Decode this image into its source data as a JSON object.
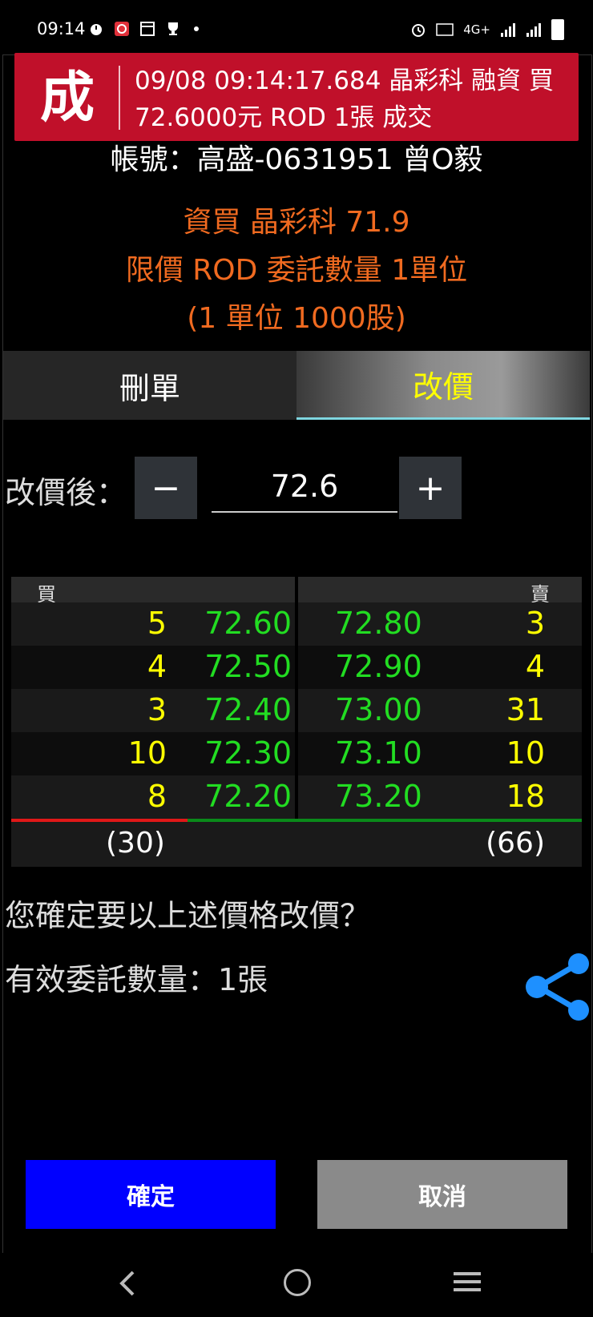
{
  "status_bar": {
    "time": "09:14",
    "left_icons": [
      "alarm-icon",
      "app-icon",
      "calendar-icon",
      "trophy-icon"
    ],
    "right_text": "4G+"
  },
  "toast": {
    "badge": "成",
    "line1": "09/08 09:14:17.684 晶彩科 融資 買",
    "line2": "72.6000元 ROD 1張 成交"
  },
  "account": "帳號：高盛-0631951 曾O毅",
  "order": {
    "line1": "資買 晶彩科 71.9",
    "line2": "限價 ROD 委託數量 1單位",
    "line3": "(1 單位 1000股)"
  },
  "tabs": [
    {
      "label": "刪單",
      "selected": false
    },
    {
      "label": "改價",
      "selected": true
    }
  ],
  "price_editor": {
    "label": "改價後：",
    "minus": "−",
    "plus": "+",
    "value": "72.6"
  },
  "order_book": {
    "buy_header": "買",
    "sell_header": "賣",
    "rows": [
      {
        "buy_vol": "5",
        "buy_price": "72.60",
        "sell_price": "72.80",
        "sell_vol": "3"
      },
      {
        "buy_vol": "4",
        "buy_price": "72.50",
        "sell_price": "72.90",
        "sell_vol": "4"
      },
      {
        "buy_vol": "3",
        "buy_price": "72.40",
        "sell_price": "73.00",
        "sell_vol": "31"
      },
      {
        "buy_vol": "10",
        "buy_price": "72.30",
        "sell_price": "73.10",
        "sell_vol": "10"
      },
      {
        "buy_vol": "8",
        "buy_price": "72.20",
        "sell_price": "73.20",
        "sell_vol": "18"
      }
    ],
    "buy_total": "(30)",
    "sell_total": "(66)"
  },
  "confirm_question": "您確定要以上述價格改價？",
  "effective_qty": "有效委託數量：1張",
  "buttons": {
    "ok": "確定",
    "cancel": "取消"
  },
  "colors": {
    "toast_bg": "#c0102a",
    "order_text": "#f06a20",
    "volume": "#ffff00",
    "price": "#22dd22",
    "ok_button": "#0000ff",
    "cancel_button": "#8a8a8a",
    "share_icon": "#1e90ff"
  }
}
